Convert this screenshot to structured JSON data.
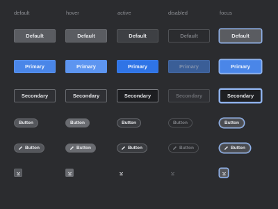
{
  "columns": [
    "default",
    "hover",
    "active",
    "disabled",
    "focus"
  ],
  "labels": {
    "default": "Default",
    "primary": "Primary",
    "secondary": "Secondary",
    "button": "Button"
  },
  "icons": {
    "pencil": "pencil-icon",
    "collapse": "collapse-down-icon"
  },
  "colors": {
    "background": "#2b2c2f",
    "primary": "#4a86e8",
    "focus_ring": "#8fb2ec"
  }
}
